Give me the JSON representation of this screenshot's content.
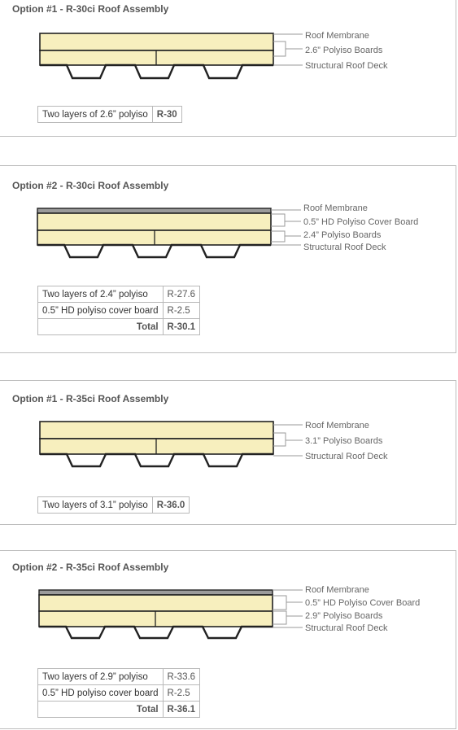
{
  "panels": [
    {
      "title": "Option #1 - R-30ci Roof Assembly",
      "labels": {
        "membrane": "Roof Membrane",
        "boards": "2.6” Polyiso Boards",
        "deck": "Structural Roof Deck"
      },
      "rows": [
        {
          "desc": "Two layers of 2.6” polyiso",
          "value": "R-30"
        }
      ]
    },
    {
      "title": "Option #2 - R-30ci Roof Assembly",
      "labels": {
        "membrane": "Roof Membrane",
        "cover": "0.5” HD Polyiso Cover Board",
        "boards": "2.4” Polyiso Boards",
        "deck": "Structural Roof Deck"
      },
      "rows": [
        {
          "desc": "Two layers of 2.4” polyiso",
          "value": "R-27.6"
        },
        {
          "desc": "0.5” HD polyiso cover board",
          "value": "R-2.5"
        }
      ],
      "total": {
        "label": "Total",
        "value": "R-30.1"
      }
    },
    {
      "title": "Option #1 - R-35ci Roof Assembly",
      "labels": {
        "membrane": "Roof Membrane",
        "boards": "3.1” Polyiso Boards",
        "deck": "Structural Roof Deck"
      },
      "rows": [
        {
          "desc": "Two layers of 3.1” polyiso",
          "value": "R-36.0"
        }
      ]
    },
    {
      "title": "Option #2 - R-35ci Roof Assembly",
      "labels": {
        "membrane": "Roof Membrane",
        "cover": "0.5” HD Polyiso Cover Board",
        "boards": "2.9” Polyiso Boards",
        "deck": "Structural Roof Deck"
      },
      "rows": [
        {
          "desc": "Two layers of 2.9” polyiso",
          "value": "R-33.6"
        },
        {
          "desc": "0.5” HD polyiso cover board",
          "value": "R-2.5"
        }
      ],
      "total": {
        "label": "Total",
        "value": "R-36.1"
      }
    }
  ],
  "colors": {
    "board_fill": "#f7efbe",
    "membrane_fill": "#9b9b9b",
    "outline": "#222222",
    "leader": "#9a9a9a"
  }
}
